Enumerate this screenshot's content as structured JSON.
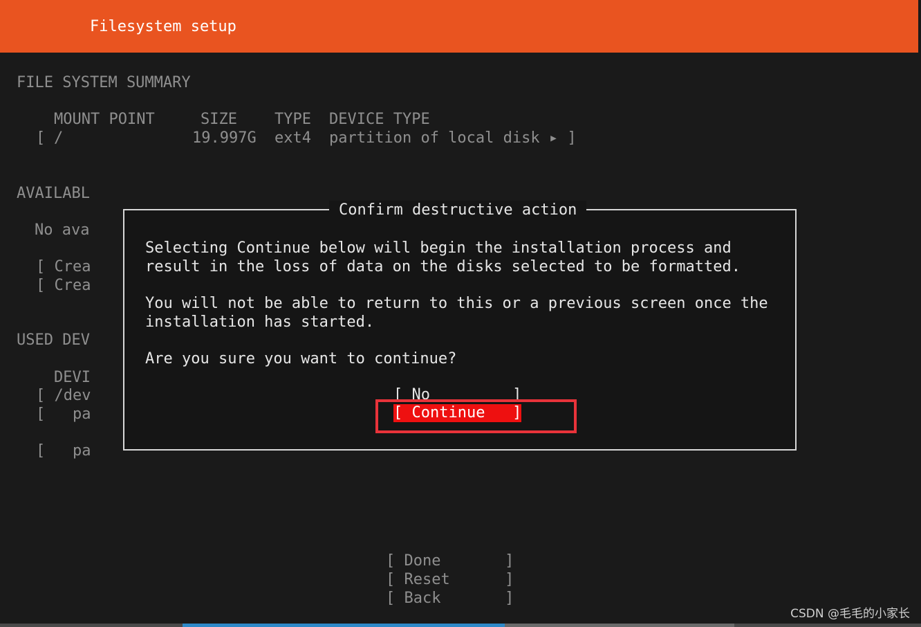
{
  "header": {
    "title": "Filesystem setup"
  },
  "summary": {
    "section_title": "FILE SYSTEM SUMMARY",
    "columns": [
      "MOUNT POINT",
      "SIZE",
      "TYPE",
      "DEVICE TYPE"
    ],
    "row": {
      "open": "[",
      "mount": "/",
      "size": "19.997G",
      "type": "ext4",
      "device_type": "partition of local disk ▸ ]"
    }
  },
  "available": {
    "section_title": "AVAILABL",
    "no_available": "No ava",
    "create_1": "[ Crea",
    "create_2": "[ Crea"
  },
  "used": {
    "section_title": "USED DEV",
    "col_header": "DEVI",
    "row_1": "[ /dev",
    "row_2": "[   pa",
    "row_3": "[   pa"
  },
  "dialog": {
    "title": "Confirm destructive action",
    "paragraph_1_line_1": "Selecting Continue below will begin the installation process and",
    "paragraph_1_line_2": "result in the loss of data on the disks selected to be formatted.",
    "paragraph_2_line_1": "You will not be able to return to this or a previous screen once the",
    "paragraph_2_line_2": "installation has started.",
    "question": "Are you sure you want to continue?",
    "no_button": "[ No         ]",
    "continue_button": "[ Continue   ]"
  },
  "footer_buttons": {
    "done": "[ Done       ]",
    "reset": "[ Reset      ]",
    "back": "[ Back       ]"
  },
  "watermark": "CSDN @毛毛的小家长",
  "colors": {
    "header": "#e95420",
    "selected_button": "#ee1010",
    "annotation_box": "#e8333a",
    "progress": "#2e89c8"
  }
}
